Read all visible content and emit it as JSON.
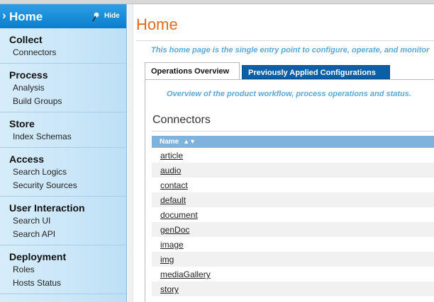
{
  "sidebar": {
    "home_label": "Home",
    "hide_label": "Hide",
    "groups": [
      {
        "title": "Collect",
        "items": [
          "Connectors"
        ]
      },
      {
        "title": "Process",
        "items": [
          "Analysis",
          "Build Groups"
        ]
      },
      {
        "title": "Store",
        "items": [
          "Index Schemas"
        ]
      },
      {
        "title": "Access",
        "items": [
          "Search Logics",
          "Security Sources"
        ]
      },
      {
        "title": "User Interaction",
        "items": [
          "Search UI",
          "Search API"
        ]
      },
      {
        "title": "Deployment",
        "items": [
          "Roles",
          "Hosts Status"
        ]
      }
    ]
  },
  "main": {
    "title": "Home",
    "intro": "This home page is the single entry point to configure, operate, and monitor",
    "tabs": [
      "Operations Overview",
      "Previously Applied Configurations"
    ],
    "overview_text": "Overview of the product workflow, process operations and status.",
    "section_title": "Connectors",
    "table": {
      "header": "Name",
      "rows": [
        "article",
        "audio",
        "contact",
        "default",
        "document",
        "genDoc",
        "image",
        "img",
        "mediaGallery",
        "story"
      ]
    }
  },
  "colors": {
    "accent_title": "#e06b1f",
    "sidebar_head": "#0a7fcd",
    "tab_inactive": "#0b5fa6",
    "table_header": "#7fb3de",
    "intro_text": "#5aa8d8"
  },
  "icons": {
    "home_chevron": "chevron-right-icon",
    "hide": "pin-icon",
    "sort": "sort-icon"
  }
}
